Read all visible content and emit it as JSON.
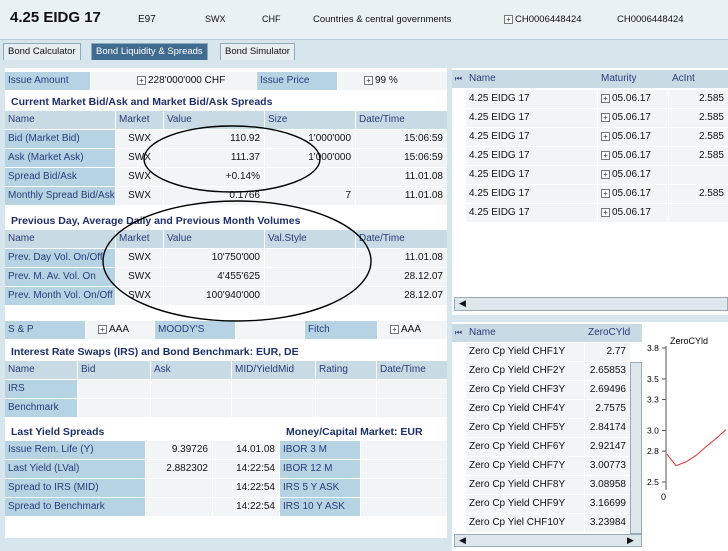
{
  "header": {
    "title": "4.25 EIDG 17",
    "code": "E97",
    "exchange": "SWX",
    "currency": "CHF",
    "issuer_type": "Countries & central governments",
    "isin1": "CH0006448424",
    "isin2": "CH0006448424"
  },
  "tabs": [
    "Bond Calculator",
    "Bond Liquidity & Spreads",
    "Bond Simulator"
  ],
  "issue": {
    "amount_label": "Issue Amount",
    "amount_value": "228'000'000 CHF",
    "price_label": "Issue Price",
    "price_value": "99 %"
  },
  "current": {
    "title": "Current Market Bid/Ask and Market Bid/Ask Spreads",
    "cols": [
      "Name",
      "Market",
      "Value",
      "Size",
      "Date/Time"
    ],
    "rows": [
      [
        "Bid (Market Bid)",
        "SWX",
        "110.92",
        "1'000'000",
        "15:06:59"
      ],
      [
        "Ask (Market Ask)",
        "SWX",
        "111.37",
        "1'000'000",
        "15:06:59"
      ],
      [
        "Spread Bid/Ask",
        "SWX",
        "+0.14%",
        "",
        "11.01.08"
      ],
      [
        "Monthly Spread Bid/Ask",
        "SWX",
        "0.1766",
        "7",
        "11.01.08"
      ]
    ]
  },
  "previous": {
    "title": "Previous Day, Average Daily and Previous Month Volumes",
    "cols": [
      "Name",
      "Market",
      "Value",
      "Val.Style",
      "Date/Time"
    ],
    "rows": [
      [
        "Prev. Day Vol. On/Off",
        "SWX",
        "10'750'000",
        "",
        "11.01.08"
      ],
      [
        "Prev. M. Av. Vol. On",
        "SWX",
        "4'455'625",
        "",
        "28.12.07"
      ],
      [
        "Prev. Month Vol. On/Off",
        "SWX",
        "100'940'000",
        "",
        "28.12.07"
      ]
    ]
  },
  "ratings": {
    "sp_label": "S & P",
    "sp_value": "AAA",
    "moodys_label": "MOODY'S",
    "fitch_label": "Fitch",
    "fitch_value": "AAA"
  },
  "irs": {
    "title": "Interest Rate Swaps (IRS) and Bond Benchmark: EUR, DE",
    "cols": [
      "Name",
      "Bid",
      "Ask",
      "MID/YieldMid",
      "Rating",
      "Date/Time"
    ],
    "rows": [
      "IRS",
      "Benchmark"
    ]
  },
  "last_yield": {
    "title": "Last Yield Spreads",
    "rows": [
      [
        "Issue Rem. Life (Y)",
        "9.39726",
        "14.01.08"
      ],
      [
        "Last Yield (LVal)",
        "2.882302",
        "14:22:54"
      ],
      [
        "Spread to IRS (MID)",
        "",
        "14:22:54"
      ],
      [
        "Spread to Benchmark",
        "",
        "14:22:54"
      ]
    ]
  },
  "money_market": {
    "title": "Money/Capital Market: EUR",
    "rows": [
      "IBOR 3 M",
      "IBOR 12 M",
      "IRS 5 Y ASK",
      "IRS 10 Y ASK"
    ]
  },
  "bond_list": {
    "cols": [
      "Name",
      "Maturity",
      "AcInt"
    ],
    "rows": [
      [
        "4.25 EIDG 17",
        "05.06.17",
        "2.585"
      ],
      [
        "4.25 EIDG 17",
        "05.06.17",
        "2.585"
      ],
      [
        "4.25 EIDG 17",
        "05.06.17",
        "2.585"
      ],
      [
        "4.25 EIDG 17",
        "05.06.17",
        "2.585"
      ],
      [
        "4.25 EIDG 17",
        "05.06.17",
        ""
      ],
      [
        "4.25 EIDG 17",
        "05.06.17",
        "2.585"
      ],
      [
        "4.25 EIDG 17",
        "05.06.17",
        ""
      ]
    ]
  },
  "zero_list": {
    "cols": [
      "Name",
      "ZeroCYld"
    ],
    "rows": [
      [
        "Zero Cp Yield CHF1Y",
        "2.77"
      ],
      [
        "Zero Cp Yield CHF2Y",
        "2.65853"
      ],
      [
        "Zero Cp Yield CHF3Y",
        "2.69496"
      ],
      [
        "Zero Cp Yield CHF4Y",
        "2.7575"
      ],
      [
        "Zero Cp Yield CHF5Y",
        "2.84174"
      ],
      [
        "Zero Cp Yield CHF6Y",
        "2.92147"
      ],
      [
        "Zero Cp Yield CHF7Y",
        "3.00773"
      ],
      [
        "Zero Cp Yield CHF8Y",
        "3.08958"
      ],
      [
        "Zero Cp Yield CHF9Y",
        "3.16699"
      ],
      [
        "Zero Cp Yiel CHF10Y",
        "3.23984"
      ]
    ]
  },
  "mini_chart": {
    "title": "ZeroCYld",
    "yticks": [
      "3.8",
      "3.5",
      "3.3",
      "3.0",
      "2.8",
      "2.5"
    ],
    "xtick": "0"
  },
  "colors": {
    "label_bg": "#b6d3e4",
    "accent": "#3f6c90"
  }
}
